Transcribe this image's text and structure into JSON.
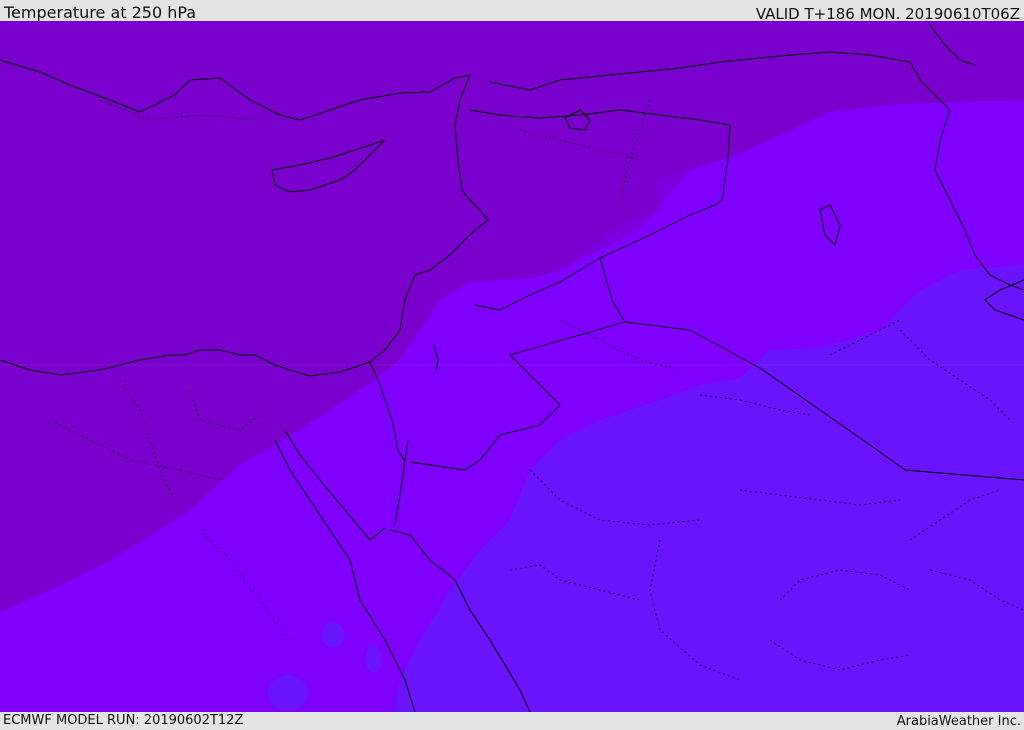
{
  "header": {
    "title": "Temperature at 250 hPa",
    "valid": "VALID T+186 MON. 20190610T06Z"
  },
  "footer": {
    "model_run": "ECMWF MODEL RUN: 20190602T12Z",
    "credit": "ArabiaWeather Inc."
  },
  "map": {
    "field": "temperature",
    "level": "250 hPa",
    "colors": {
      "coldest_zone": "#7a00c4",
      "cold_zone": "#7b00d8",
      "mid_zone": "#7f00ff",
      "warm_zone": "#6a14fd",
      "coastline": "#000000",
      "border": "#000000"
    }
  }
}
